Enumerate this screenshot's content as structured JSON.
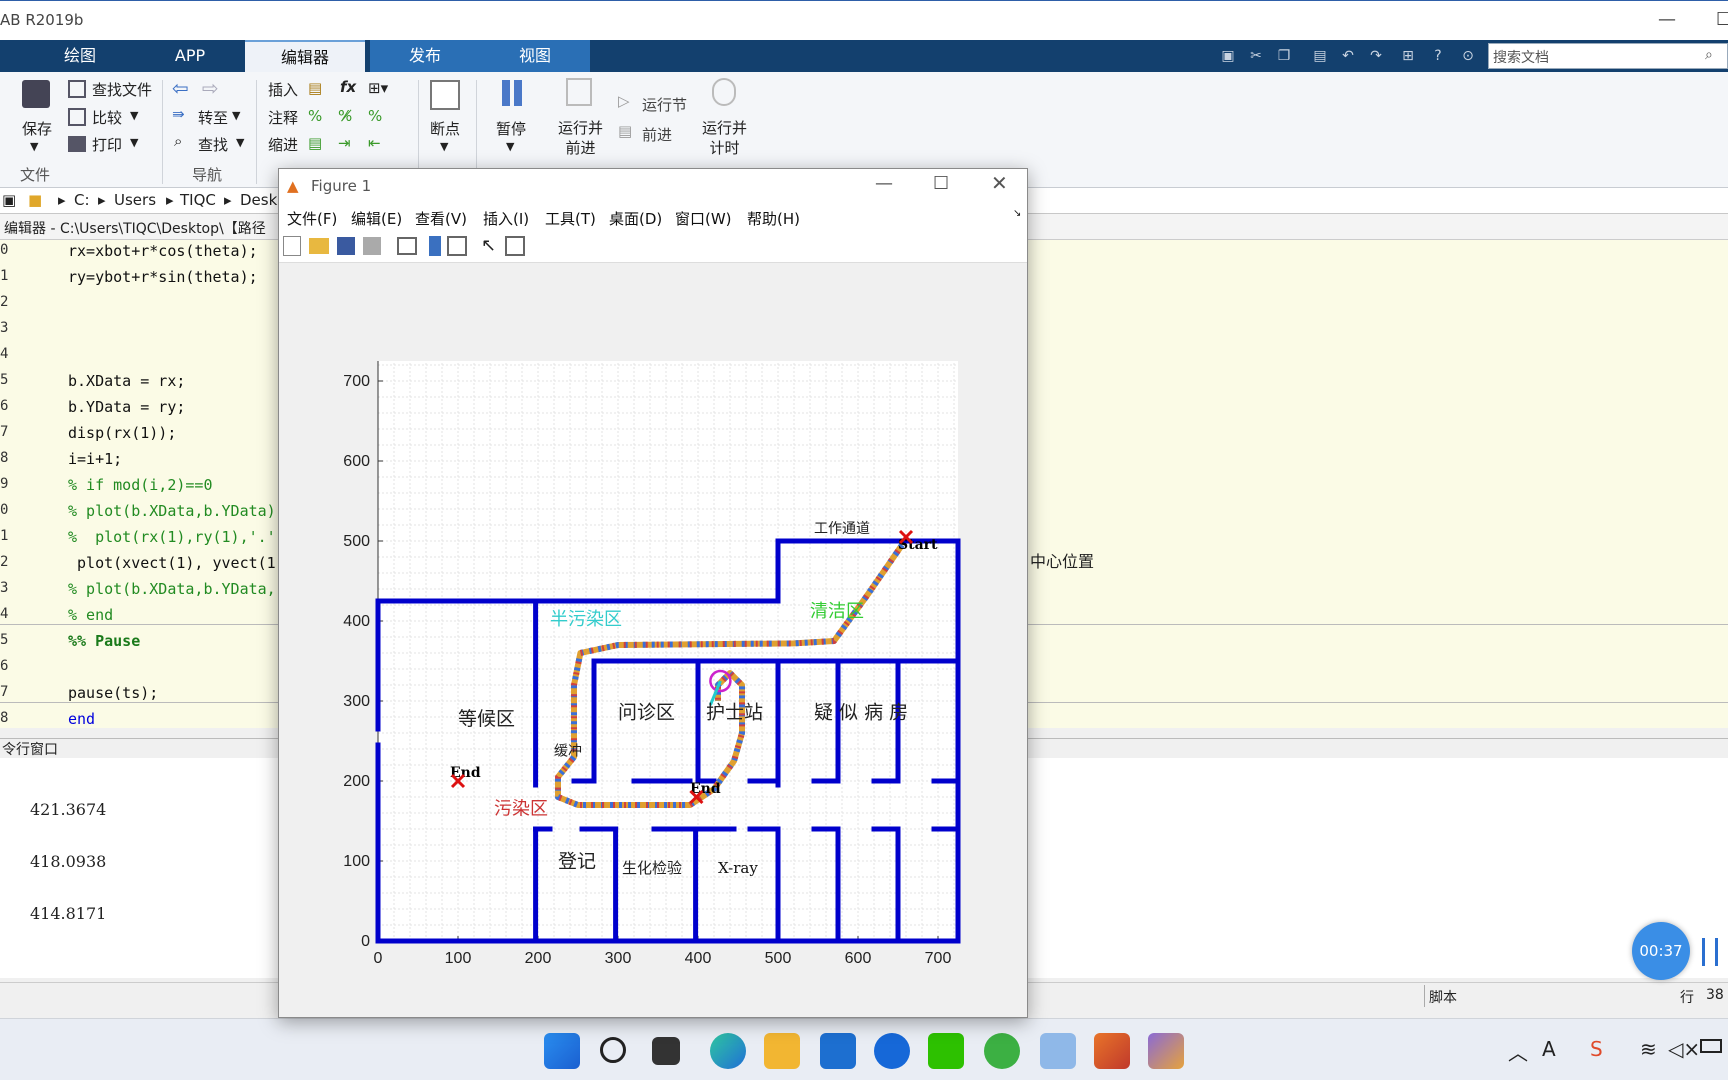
{
  "app": {
    "title": "AB R2019b"
  },
  "ribbon": {
    "tabs": [
      "绘图",
      "APP",
      "编辑器",
      "发布",
      "视图"
    ],
    "active_tab": "编辑器",
    "search_placeholder": "搜索文档",
    "file": {
      "save": "保存",
      "find_files": "查找文件",
      "compare": "比较",
      "print": "打印",
      "group": "文件"
    },
    "nav": {
      "goto": "转至",
      "find": "查找",
      "group": "导航"
    },
    "edit": {
      "insert": "插入",
      "comment": "注释",
      "indent": "缩进",
      "fx": "fx"
    },
    "breakpoints": {
      "label": "断点"
    },
    "run": {
      "pause": "暂停",
      "run_advance": "运行并\n前进",
      "run_section": "运行节",
      "advance": "前进",
      "run_time": "运行并\n计时"
    }
  },
  "path": {
    "segments": [
      "C:",
      "Users",
      "TIQC",
      "Desk"
    ]
  },
  "editor": {
    "title": "编辑器 - C:\\Users\\TIQC\\Desktop\\【路径",
    "lines": [
      {
        "no": "0",
        "code": "rx=xbot+r*cos(theta);",
        "type": "normal"
      },
      {
        "no": "1",
        "code": "ry=ybot+r*sin(theta);",
        "type": "normal"
      },
      {
        "no": "2",
        "code": "",
        "type": "normal"
      },
      {
        "no": "3",
        "code": "",
        "type": "normal"
      },
      {
        "no": "4",
        "code": "",
        "type": "normal"
      },
      {
        "no": "5",
        "code": "b.XData = rx;",
        "type": "normal"
      },
      {
        "no": "6",
        "code": "b.YData = ry;",
        "type": "normal"
      },
      {
        "no": "7",
        "code": "disp(rx(1));",
        "type": "normal"
      },
      {
        "no": "8",
        "code": "i=i+1;",
        "type": "normal"
      },
      {
        "no": "9",
        "code": "% if mod(i,2)==0",
        "type": "cm"
      },
      {
        "no": "0",
        "code": "% plot(b.XData,b.YData)",
        "type": "cm"
      },
      {
        "no": "1",
        "code": "%  plot(rx(1),ry(1),'.',",
        "type": "cm"
      },
      {
        "no": "2",
        "code": " plot(xvect(1), yvect(1",
        "type": "normal"
      },
      {
        "no": "3",
        "code": "% plot(b.XData,b.YData,",
        "type": "cm"
      },
      {
        "no": "4",
        "code": "% end",
        "type": "cm"
      },
      {
        "no": "5",
        "code": "%% Pause",
        "type": "sec"
      },
      {
        "no": "6",
        "code": "",
        "type": "normal"
      },
      {
        "no": "7",
        "code": "pause(ts);",
        "type": "normal"
      },
      {
        "no": "8",
        "code": "end",
        "type": "kw"
      }
    ],
    "right_text": "中心位置"
  },
  "command": {
    "title": "令行窗口",
    "outputs": [
      "421.3674",
      "418.0938",
      "414.8171"
    ]
  },
  "status": {
    "script": "脚本",
    "row": "行",
    "row_value": "38"
  },
  "timer": "00:37",
  "figure": {
    "title": "Figure 1",
    "menus": [
      "文件(F)",
      "编辑(E)",
      "查看(V)",
      "插入(I)",
      "工具(T)",
      "桌面(D)",
      "窗口(W)",
      "帮助(H)"
    ]
  },
  "chart_data": {
    "type": "scatter",
    "xlim": [
      0,
      725
    ],
    "ylim": [
      0,
      725
    ],
    "xticks": [
      0,
      100,
      200,
      300,
      400,
      500,
      600,
      700
    ],
    "yticks": [
      0,
      100,
      200,
      300,
      400,
      500,
      600,
      700
    ],
    "grid": "on (minor)",
    "wall_color": "#0000cc",
    "walls": [
      [
        [
          0,
          0
        ],
        [
          725,
          0
        ]
      ],
      [
        [
          0,
          0
        ],
        [
          0,
          245
        ]
      ],
      [
        [
          0,
          265
        ],
        [
          0,
          425
        ]
      ],
      [
        [
          0,
          425
        ],
        [
          500,
          425
        ]
      ],
      [
        [
          500,
          425
        ],
        [
          500,
          500
        ]
      ],
      [
        [
          500,
          500
        ],
        [
          725,
          500
        ]
      ],
      [
        [
          725,
          500
        ],
        [
          725,
          0
        ]
      ],
      [
        [
          197,
          425
        ],
        [
          197,
          195
        ]
      ],
      [
        [
          197,
          140
        ],
        [
          197,
          0
        ]
      ],
      [
        [
          270,
          350
        ],
        [
          725,
          350
        ]
      ],
      [
        [
          270,
          350
        ],
        [
          270,
          200
        ]
      ],
      [
        [
          245,
          200
        ],
        [
          270,
          200
        ]
      ],
      [
        [
          320,
          200
        ],
        [
          390,
          200
        ]
      ],
      [
        [
          400,
          350
        ],
        [
          400,
          200
        ]
      ],
      [
        [
          400,
          200
        ],
        [
          420,
          200
        ]
      ],
      [
        [
          465,
          200
        ],
        [
          500,
          200
        ]
      ],
      [
        [
          500,
          350
        ],
        [
          500,
          195
        ]
      ],
      [
        [
          545,
          200
        ],
        [
          575,
          200
        ]
      ],
      [
        [
          575,
          350
        ],
        [
          575,
          200
        ]
      ],
      [
        [
          620,
          200
        ],
        [
          650,
          200
        ]
      ],
      [
        [
          650,
          350
        ],
        [
          650,
          200
        ]
      ],
      [
        [
          695,
          200
        ],
        [
          725,
          200
        ]
      ],
      [
        [
          197,
          140
        ],
        [
          215,
          140
        ]
      ],
      [
        [
          255,
          140
        ],
        [
          297,
          140
        ]
      ],
      [
        [
          297,
          140
        ],
        [
          297,
          0
        ]
      ],
      [
        [
          345,
          140
        ],
        [
          397,
          140
        ]
      ],
      [
        [
          397,
          140
        ],
        [
          397,
          0
        ]
      ],
      [
        [
          397,
          140
        ],
        [
          445,
          140
        ]
      ],
      [
        [
          465,
          140
        ],
        [
          500,
          140
        ]
      ],
      [
        [
          500,
          140
        ],
        [
          500,
          0
        ]
      ],
      [
        [
          545,
          140
        ],
        [
          575,
          140
        ]
      ],
      [
        [
          575,
          140
        ],
        [
          575,
          0
        ]
      ],
      [
        [
          620,
          140
        ],
        [
          650,
          140
        ]
      ],
      [
        [
          650,
          140
        ],
        [
          650,
          0
        ]
      ],
      [
        [
          695,
          140
        ],
        [
          725,
          140
        ]
      ]
    ],
    "labels": [
      {
        "text": "工作通道",
        "x": 545,
        "y": 510,
        "color": "#222222",
        "size": 14
      },
      {
        "text": "Start",
        "x": 650,
        "y": 490,
        "color": "#000000",
        "size": 14,
        "bold": true
      },
      {
        "text": "清洁区",
        "x": 540,
        "y": 405,
        "color": "#33cc33",
        "size": 18
      },
      {
        "text": "半污染区",
        "x": 215,
        "y": 395,
        "color": "#33cccc",
        "size": 18
      },
      {
        "text": "等候区",
        "x": 100,
        "y": 270,
        "color": "#222222",
        "size": 19
      },
      {
        "text": "问诊区",
        "x": 300,
        "y": 278,
        "color": "#222222",
        "size": 19
      },
      {
        "text": "护士站",
        "x": 410,
        "y": 278,
        "color": "#222222",
        "size": 19
      },
      {
        "text": "疑 似 病 房",
        "x": 545,
        "y": 278,
        "color": "#222222",
        "size": 19
      },
      {
        "text": "缓冲",
        "x": 220,
        "y": 232,
        "color": "#222222",
        "size": 14
      },
      {
        "text": "End",
        "x": 90,
        "y": 205,
        "color": "#000000",
        "size": 14,
        "bold": true
      },
      {
        "text": "End",
        "x": 390,
        "y": 185,
        "color": "#000000",
        "size": 14,
        "bold": true
      },
      {
        "text": "污染区",
        "x": 145,
        "y": 158,
        "color": "#cc3333",
        "size": 18
      },
      {
        "text": "登记",
        "x": 225,
        "y": 92,
        "color": "#222222",
        "size": 19
      },
      {
        "text": "生化检验",
        "x": 305,
        "y": 85,
        "color": "#222222",
        "size": 15
      },
      {
        "text": "X-ray",
        "x": 425,
        "y": 85,
        "color": "#111111",
        "size": 15
      }
    ],
    "markers": [
      {
        "type": "x",
        "x": 660,
        "y": 505,
        "color": "#dd1111"
      },
      {
        "type": "x",
        "x": 100,
        "y": 200,
        "color": "#dd1111"
      },
      {
        "type": "x",
        "x": 398,
        "y": 180,
        "color": "#dd1111"
      }
    ],
    "path": [
      [
        655,
        495
      ],
      [
        610,
        430
      ],
      [
        570,
        375
      ],
      [
        520,
        372
      ],
      [
        300,
        370
      ],
      [
        253,
        360
      ],
      [
        245,
        320
      ],
      [
        245,
        230
      ],
      [
        225,
        205
      ],
      [
        225,
        180
      ],
      [
        250,
        170
      ],
      [
        390,
        170
      ],
      [
        420,
        190
      ],
      [
        445,
        225
      ],
      [
        455,
        260
      ],
      [
        455,
        320
      ],
      [
        440,
        335
      ],
      [
        425,
        320
      ],
      [
        425,
        300
      ]
    ],
    "robot": {
      "x": 428,
      "y": 325,
      "color": "#cc22cc"
    }
  }
}
